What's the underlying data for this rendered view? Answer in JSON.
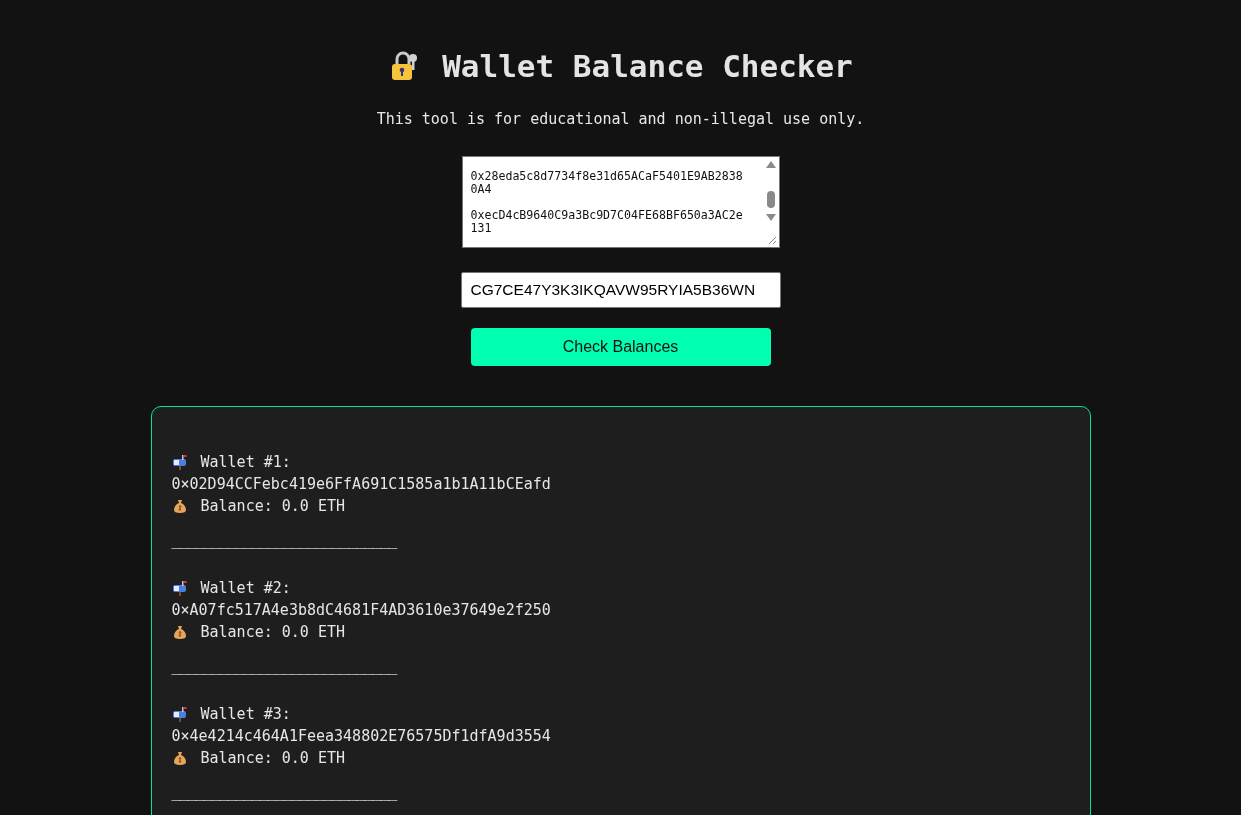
{
  "title": "Wallet Balance Checker",
  "subtitle": "This tool is for educational and non-illegal use only.",
  "addresses_field": {
    "lines": [
      "0x28eda5c8d7734f8e31d65ACaF5401E9AB28380A4",
      "0xecD4cB9640C9a3Bc9D7C04FE68BF650a3AC2e131"
    ]
  },
  "api_key_field": {
    "value": "CG7CE47Y3K3IKQAVW95RYIA5B36WN"
  },
  "check_button": "Check Balances",
  "results": [
    {
      "label": "Wallet #1:",
      "address": "0×02D94CCFebc419e6FfA691C1585a1b1A11bCEafd",
      "balance": "Balance: 0.0 ETH",
      "separator": "____________________________"
    },
    {
      "label": "Wallet #2:",
      "address": "0×A07fc517A4e3b8dC4681F4AD3610e37649e2f250",
      "balance": "Balance: 0.0 ETH",
      "separator": "____________________________"
    },
    {
      "label": "Wallet #3:",
      "address": "0×4e4214c464A1Feea348802E76575Df1dfA9d3554",
      "balance": "Balance: 0.0 ETH",
      "separator": "____________________________"
    }
  ]
}
